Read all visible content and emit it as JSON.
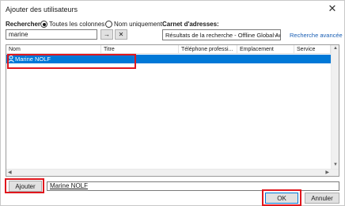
{
  "dialog": {
    "title": "Ajouter des utilisateurs",
    "close_glyph": "✕"
  },
  "search": {
    "label": "Rechercher :",
    "option_all": "Toutes les colonnes",
    "option_name": "Nom uniquement",
    "selected_option": "Toutes les colonnes",
    "query": "marine",
    "go_glyph": "→",
    "clear_glyph": "✕"
  },
  "address_book": {
    "label": "Carnet d'adresses:",
    "selected": "Résultats de la recherche - Offline Global Ac",
    "chevron": "⌵",
    "advanced_link": "Recherche avancée"
  },
  "grid": {
    "columns": [
      "Nom",
      "Titre",
      "Téléphone professi...",
      "Emplacement",
      "Service"
    ],
    "rows": [
      {
        "name": "Marine NOLF",
        "selected": true
      }
    ],
    "scroll_up": "▲",
    "scroll_down": "▼",
    "scroll_left": "◀",
    "scroll_right": "▶"
  },
  "footer": {
    "add_button": "Ajouter",
    "recipients_value": "Marine NOLF",
    "ok_button": "OK",
    "cancel_button": "Annuler"
  },
  "colors": {
    "selection": "#0078d7",
    "highlight": "#e0171d",
    "link": "#1a5fb4"
  }
}
